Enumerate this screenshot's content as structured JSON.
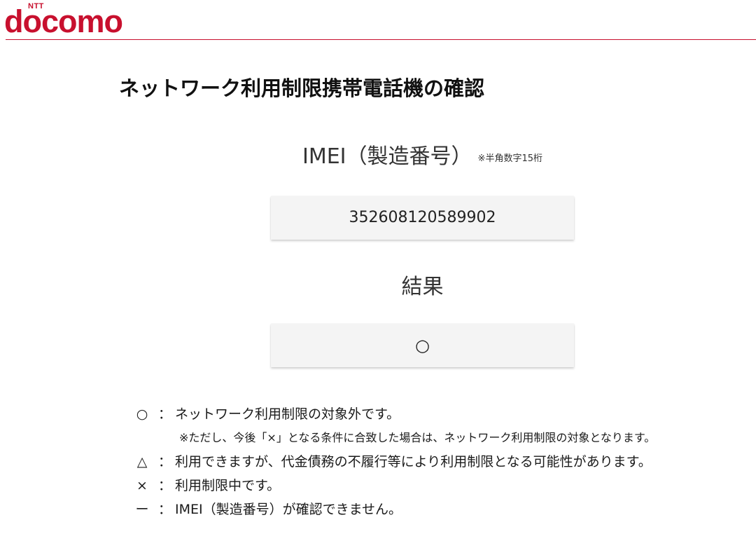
{
  "header": {
    "logo_top": "NTT",
    "logo_main": "docomo",
    "brand_color": "#c8102e"
  },
  "page": {
    "title": "ネットワーク利用制限携帯電話機の確認"
  },
  "imei": {
    "label": "IMEI（製造番号）",
    "note": "※半角数字15桁",
    "value": "352608120589902"
  },
  "result": {
    "label": "結果",
    "value": "○"
  },
  "legend": {
    "items": [
      {
        "symbol": "○",
        "separator": "：",
        "text": "ネットワーク利用制限の対象外です。"
      },
      {
        "symbol": "△",
        "separator": "：",
        "text": "利用できますが、代金債務の不履行等により利用制限となる可能性があります。"
      },
      {
        "symbol": "×",
        "separator": "：",
        "text": "利用制限中です。"
      },
      {
        "symbol": "ー",
        "separator": "：",
        "text": "IMEI（製造番号）が確認できません。"
      }
    ],
    "note": "※ただし、今後「×」となる条件に合致した場合は、ネットワーク利用制限の対象となります。"
  }
}
